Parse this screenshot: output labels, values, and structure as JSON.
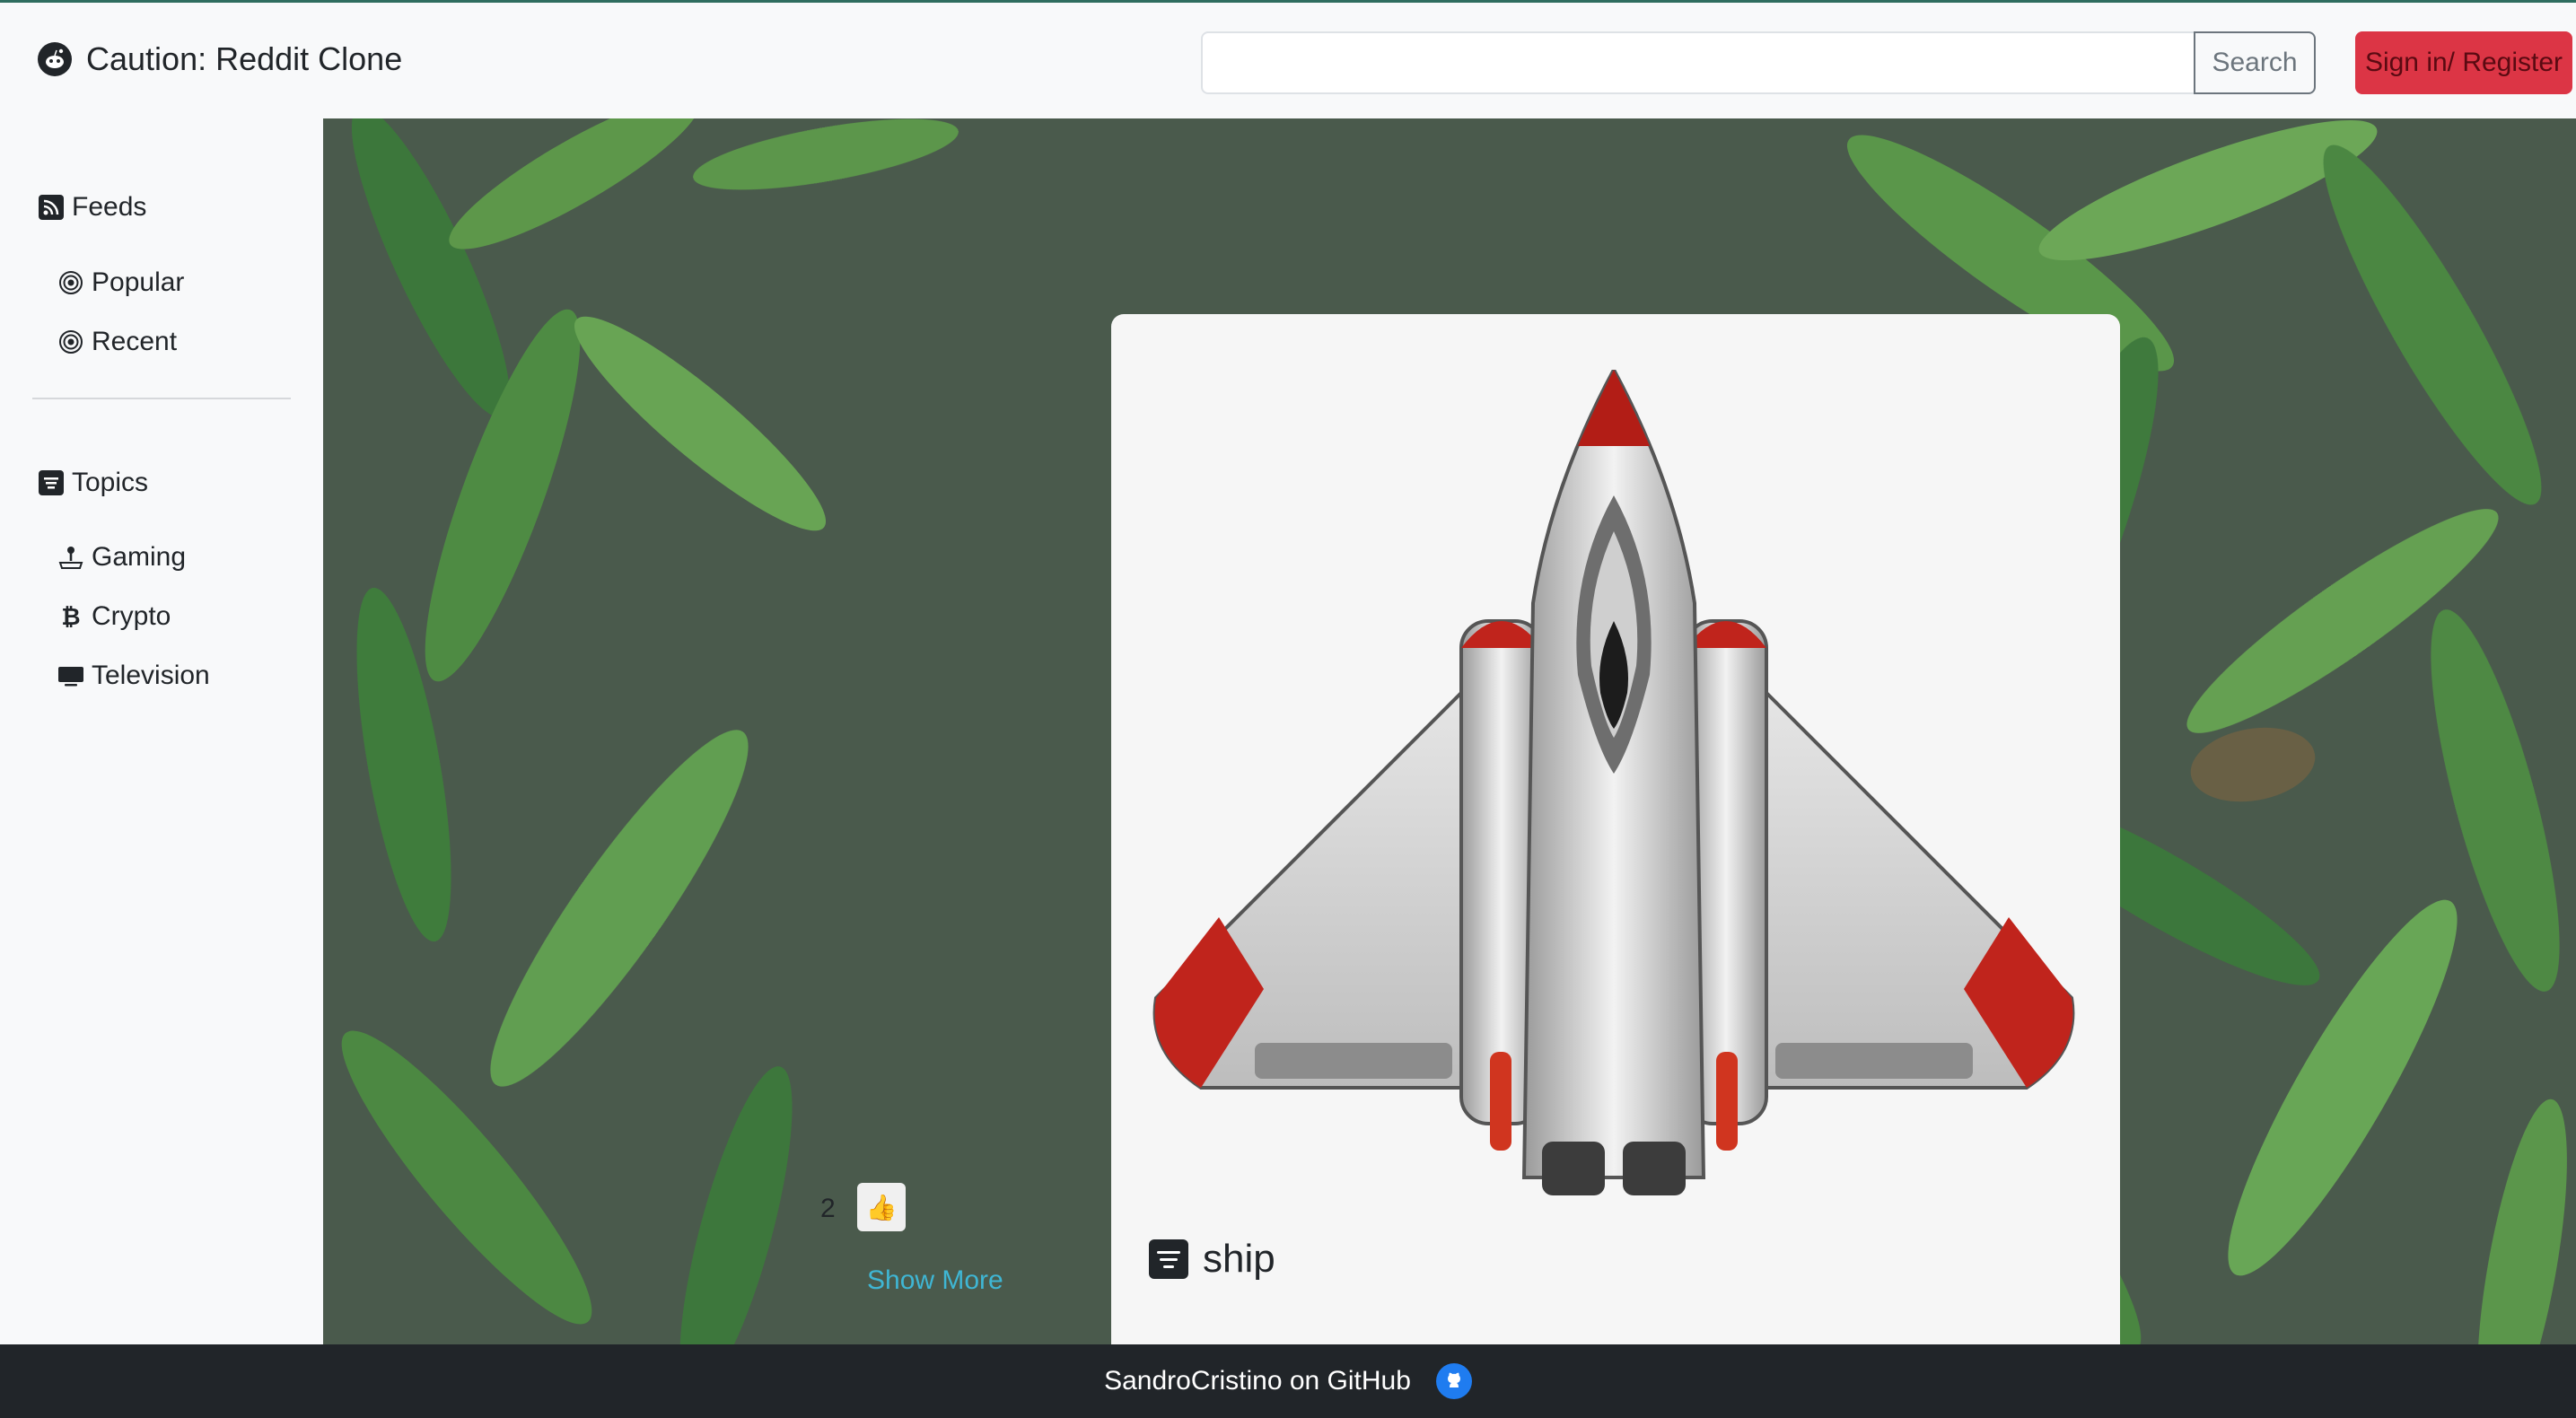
{
  "header": {
    "brand_title": "Caution: Reddit Clone",
    "search_placeholder": "",
    "search_label": "Search",
    "signin_label": "Sign in/ Register"
  },
  "sidebar": {
    "feeds_heading": "Feeds",
    "feeds": [
      {
        "label": "Popular",
        "icon": "target-icon"
      },
      {
        "label": "Recent",
        "icon": "target-icon"
      }
    ],
    "topics_heading": "Topics",
    "topics": [
      {
        "label": "Gaming",
        "icon": "joystick-icon"
      },
      {
        "label": "Crypto",
        "icon": "bitcoin-icon"
      },
      {
        "label": "Television",
        "icon": "tv-icon"
      }
    ]
  },
  "post": {
    "image": "spaceship-image",
    "title": "ship",
    "vote_count": "2",
    "like_icon": "thumbs-up-icon",
    "show_more_label": "Show More"
  },
  "footer": {
    "text": "SandroCristino on GitHub",
    "icon": "github-icon"
  },
  "colors": {
    "accent_red": "#dc3545",
    "link_cyan": "#3fb6d4",
    "footer_bg": "#212529",
    "github_blue": "#1f7cf0"
  }
}
